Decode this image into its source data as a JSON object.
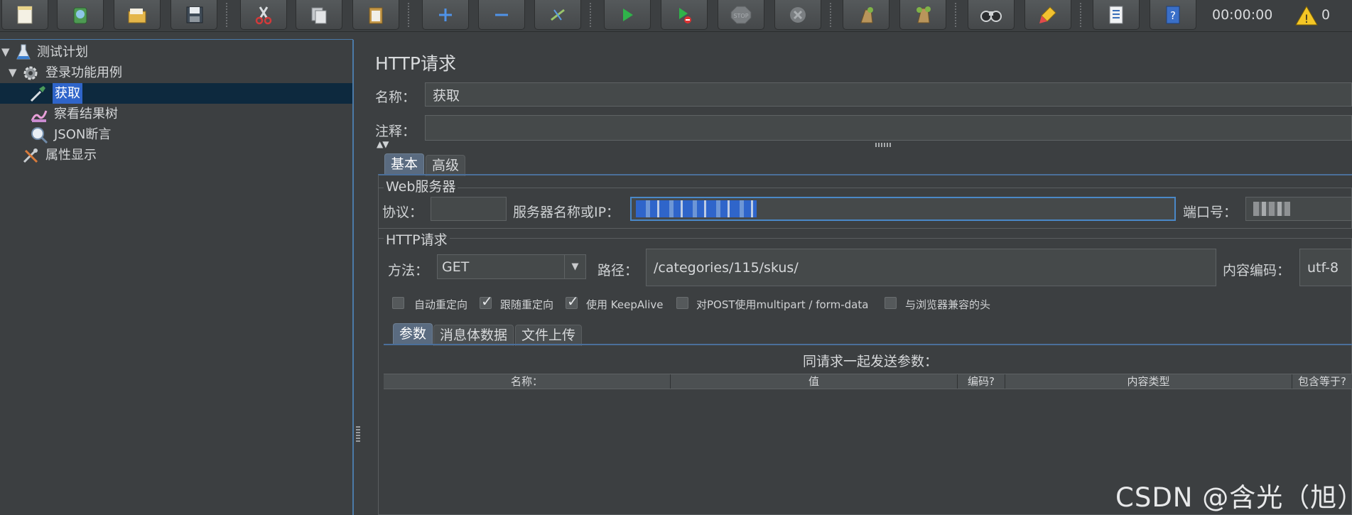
{
  "toolbar": {
    "buttons": [
      {
        "name": "new-icon"
      },
      {
        "name": "templates-icon"
      },
      {
        "name": "open-icon"
      },
      {
        "name": "save-icon"
      },
      {
        "name": "cut-icon"
      },
      {
        "name": "copy-icon"
      },
      {
        "name": "paste-icon"
      },
      {
        "name": "expand-icon"
      },
      {
        "name": "collapse-icon"
      },
      {
        "name": "toggle-icon"
      },
      {
        "name": "start-icon"
      },
      {
        "name": "start-no-pauses-icon"
      },
      {
        "name": "stop-icon"
      },
      {
        "name": "shutdown-icon"
      },
      {
        "name": "clear-icon"
      },
      {
        "name": "clear-all-icon"
      },
      {
        "name": "search-icon"
      },
      {
        "name": "reset-search-icon"
      },
      {
        "name": "function-helper-icon"
      },
      {
        "name": "help-icon"
      }
    ],
    "timer": "00:00:00",
    "warning_count": "0"
  },
  "tree": {
    "items": [
      {
        "label": "测试计划",
        "icon": "test-plan-icon",
        "expanded": true
      },
      {
        "label": "登录功能用例",
        "icon": "thread-group-icon",
        "expanded": true
      },
      {
        "label": "获取",
        "icon": "http-sampler-icon",
        "selected": true
      },
      {
        "label": "察看结果树",
        "icon": "result-tree-icon"
      },
      {
        "label": "JSON断言",
        "icon": "json-assertion-icon"
      },
      {
        "label": "属性显示",
        "icon": "property-display-icon"
      }
    ]
  },
  "panel": {
    "title": "HTTP请求",
    "name_label": "名称：",
    "name_value": "获取",
    "comment_label": "注释：",
    "comment_value": "",
    "tabs": [
      "基本",
      "高级"
    ],
    "web_server": {
      "group_title": "Web服务器",
      "protocol_label": "协议：",
      "protocol_value": "",
      "server_label": "服务器名称或IP：",
      "port_label": "端口号："
    },
    "http_request": {
      "group_title": "HTTP请求",
      "method_label": "方法：",
      "method_value": "GET",
      "path_label": "路径：",
      "path_value": "/categories/115/skus/",
      "encoding_label": "内容编码：",
      "encoding_value": "utf-8",
      "checkboxes": [
        {
          "label": "自动重定向",
          "checked": false
        },
        {
          "label": "跟随重定向",
          "checked": true
        },
        {
          "label": "使用 KeepAlive",
          "checked": true
        },
        {
          "label": "对POST使用multipart / form-data",
          "checked": false
        },
        {
          "label": "与浏览器兼容的头",
          "checked": false
        }
      ],
      "sub_tabs": [
        "参数",
        "消息体数据",
        "文件上传"
      ],
      "table_caption": "同请求一起发送参数：",
      "columns": [
        "名称：",
        "值",
        "编码?",
        "内容类型",
        "包含等于?"
      ]
    }
  },
  "watermark": "CSDN @含光（旭）"
}
